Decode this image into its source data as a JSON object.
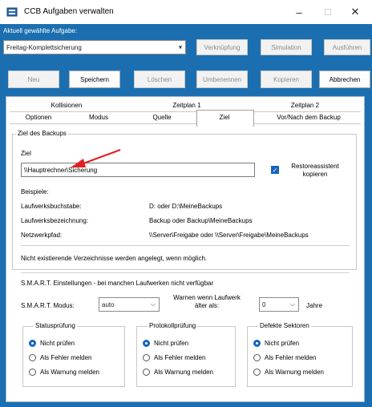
{
  "window": {
    "title": "CCB Aufgaben verwalten",
    "min": "–",
    "max": "☐",
    "close": "✕"
  },
  "task": {
    "label": "Aktuell gewählte Aufgabe:",
    "selected": "Freitag-Komplettsicherung",
    "buttons": [
      "Verknüpfung",
      "Simulation",
      "Ausführen"
    ]
  },
  "toolbar": {
    "neu": "Neu",
    "speichern": "Speichern",
    "loeschen": "Löschen",
    "umbenennen": "Umbenennen",
    "kopieren": "Kopieren",
    "abbrechen": "Abbrechen"
  },
  "tabs": {
    "row1": [
      "Kollisionen",
      "Zeitplan 1",
      "Zeitplan 2"
    ],
    "row2": [
      "Optionen",
      "Modus",
      "Quelle",
      "Ziel",
      "Vor/Nach dem Backup"
    ]
  },
  "ziel": {
    "group": "Ziel des Backups",
    "ziel_label": "Ziel",
    "path": "\\\\Hauptrechner\\Sicherung",
    "restore": "Restoreassistent kopieren",
    "beispiele": "Beispiele:",
    "examples": [
      {
        "label": "Laufwerksbuchstabe:",
        "value": "D: oder D:\\MeineBackups"
      },
      {
        "label": "Laufwerksbezeichnung:",
        "value": "Backup oder Backup\\MeineBackups"
      },
      {
        "label": "Netzwerkpfad:",
        "value": "\\\\Server\\Freigabe oder \\\\Server\\Freigabe\\MeineBackups"
      }
    ],
    "note": "Nicht existierende Verzeichnisse werden angelegt, wenn möglich."
  },
  "smart": {
    "heading": "S.M.A.R.T. Einstellungen - bei manchen Laufwerken nicht verfügbar",
    "mode_label": "S.M.A.R.T. Modus:",
    "mode_value": "auto",
    "warn_label": "Warnen wenn Laufwerk älter als:",
    "years_value": "0",
    "years_label": "Jahre",
    "groups": [
      {
        "title": "Statusprüfung",
        "options": [
          "Nicht prüfen",
          "Als Fehler melden",
          "Als Warnung melden"
        ]
      },
      {
        "title": "Protokollprüfung",
        "options": [
          "Nicht prüfen",
          "Als Fehler melden",
          "Als Warnung melden"
        ]
      },
      {
        "title": "Defekte Sektoren",
        "options": [
          "Nicht prüfen",
          "Als Fehler melden",
          "Als Warnung melden"
        ]
      }
    ]
  },
  "colors": {
    "frame": "#1b6fb0",
    "accent": "#1565c0",
    "arrow": "#e02020"
  }
}
